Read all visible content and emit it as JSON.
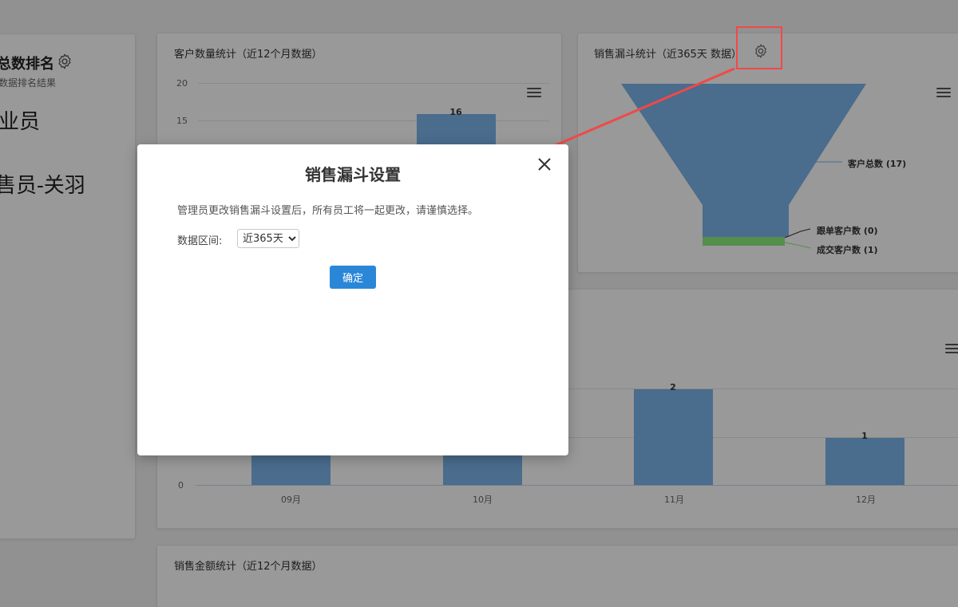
{
  "ranking": {
    "title": "总数排名",
    "subtitle": "数据排名结果",
    "line1": "业员",
    "line2": "售员-关羽"
  },
  "customer_chart": {
    "title": "客户数量统计（近12个月数据）",
    "y_ticks": [
      "20",
      "15"
    ],
    "bar_label": "16"
  },
  "funnel_chart": {
    "title": "销售漏斗统计（近365天 数据）",
    "labels": [
      "客户总数 (17)",
      "跟单客户数 (0)",
      "成交客户数 (1)"
    ]
  },
  "monthly_chart": {
    "categories": [
      "09月",
      "10月",
      "11月",
      "12月"
    ],
    "y_zero": "0",
    "bar_labels": [
      "2",
      "1"
    ]
  },
  "sales_amount": {
    "title": "销售金额统计（近12个月数据）"
  },
  "chart_data": [
    {
      "type": "bar",
      "categories": [
        "10月"
      ],
      "values": [
        16
      ],
      "ylim": [
        0,
        20
      ],
      "title": "客户数量统计（近12个月数据）"
    },
    {
      "type": "bar",
      "categories": [
        "09月",
        "10月",
        "11月",
        "12月"
      ],
      "values": [
        null,
        null,
        2,
        1
      ],
      "ylim": [
        0,
        2
      ]
    }
  ],
  "modal": {
    "title": "销售漏斗设置",
    "description": "管理员更改销售漏斗设置后，所有员工将一起更改，请谨慎选择。",
    "field_label": "数据区间:",
    "select_value": "近365天",
    "confirm_label": "确定"
  },
  "colors": {
    "bar": "#7cb5ec",
    "funnel_main": "#7cb5ec",
    "funnel_closed": "#90ed7d",
    "highlight": "#f24848",
    "primary_button": "#2a87d8"
  }
}
